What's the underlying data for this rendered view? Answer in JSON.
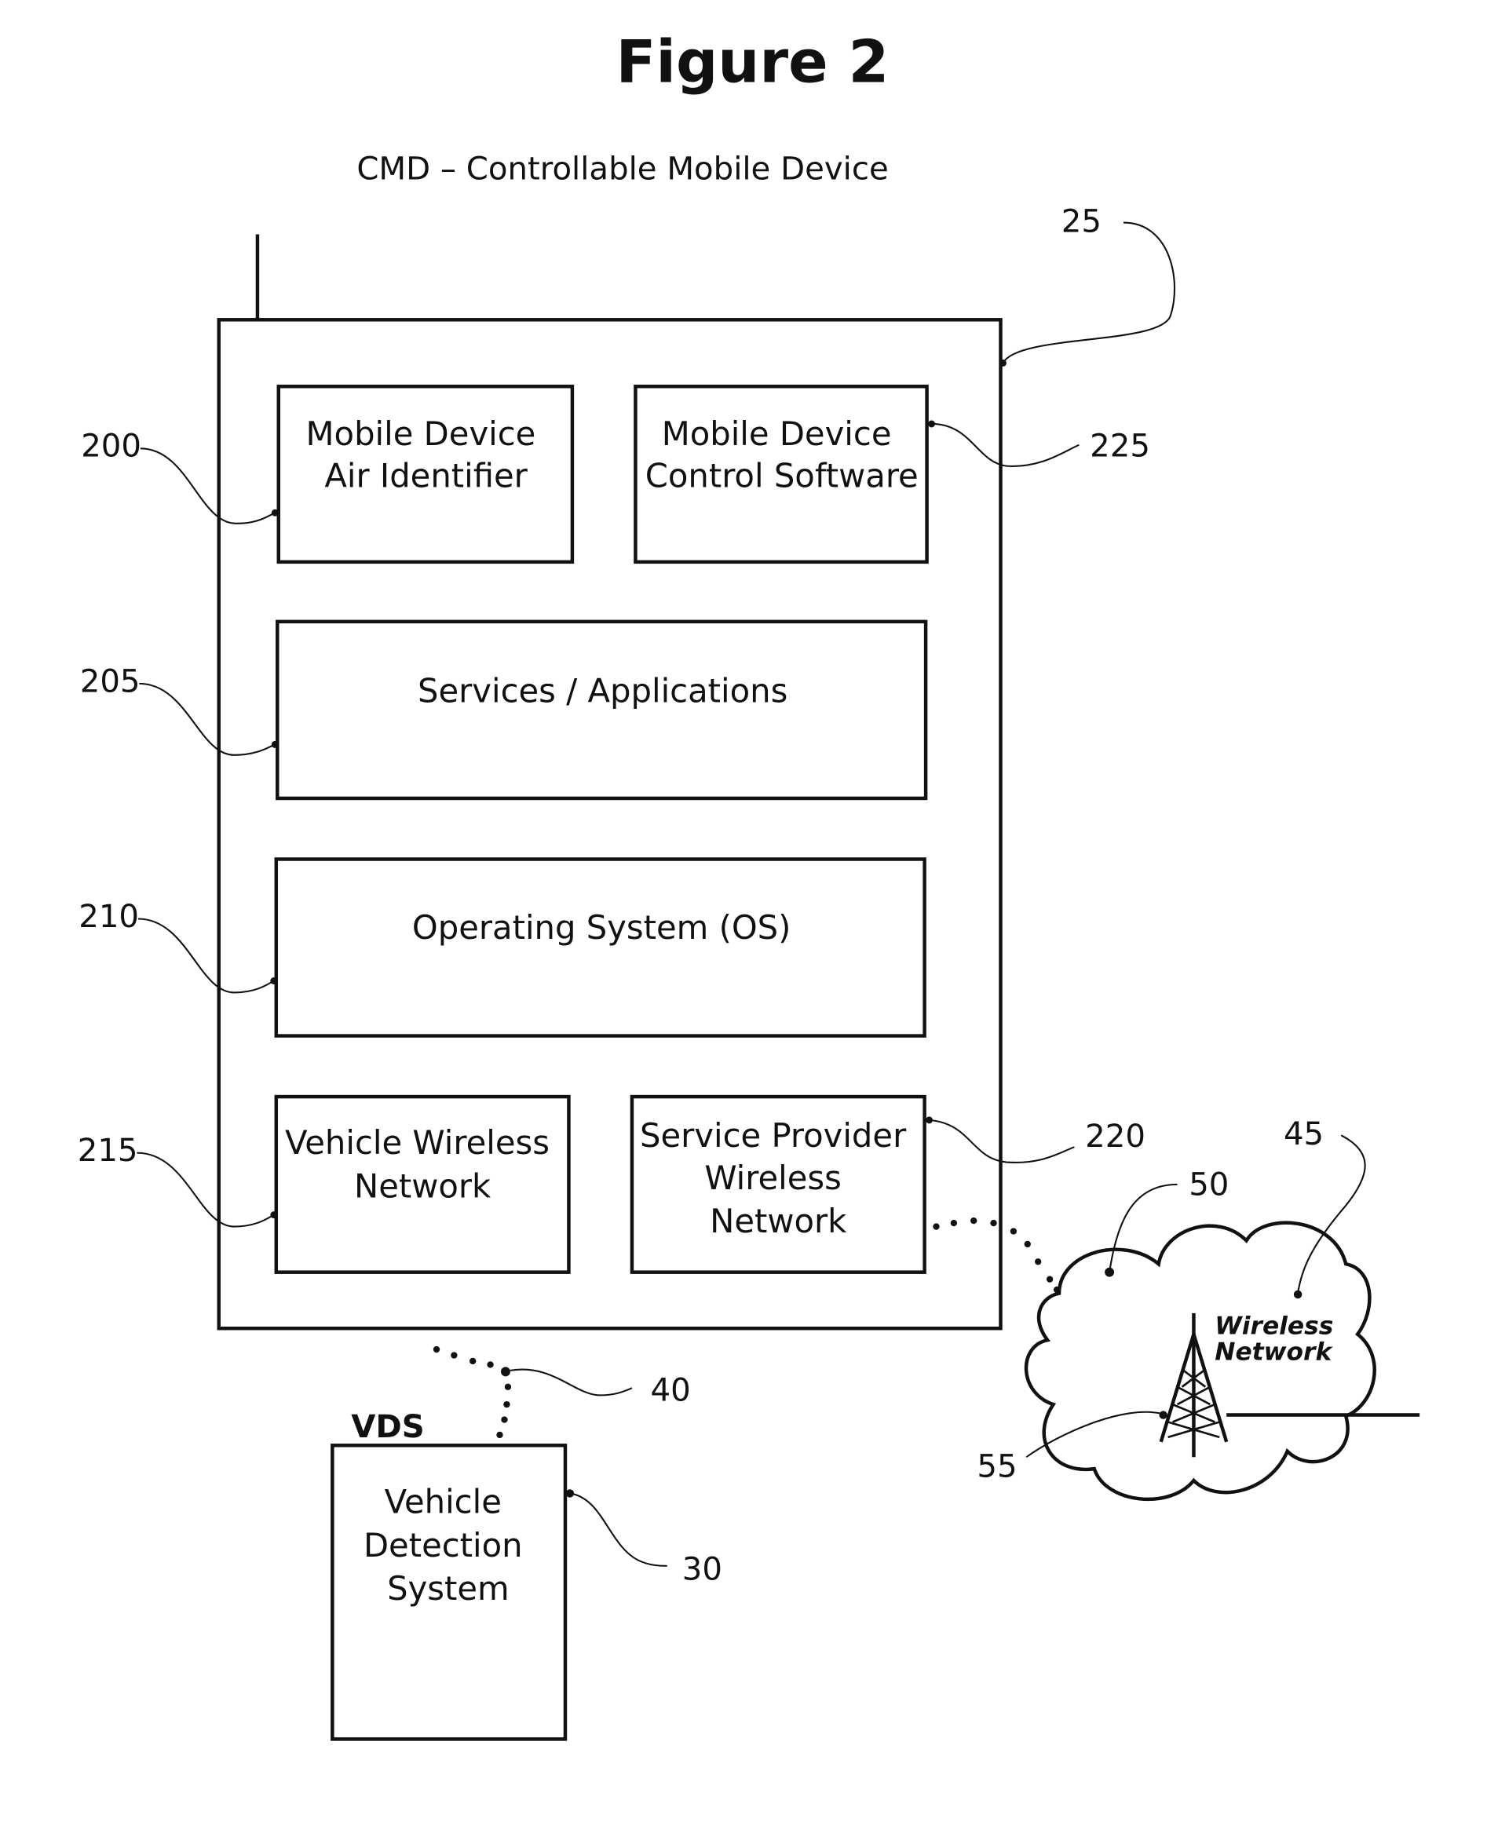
{
  "figure": {
    "title": "Figure 2",
    "subtitle": "CMD – Controllable Mobile Device"
  },
  "device": {
    "ref": "25",
    "components": [
      {
        "id": "air-identifier",
        "ref": "200",
        "lines": [
          "Mobile Device",
          "Air Identifier"
        ]
      },
      {
        "id": "control-software",
        "ref": "225",
        "lines": [
          "Mobile Device",
          "Control Software"
        ]
      },
      {
        "id": "services-applications",
        "ref": "205",
        "lines": [
          "Services / Applications"
        ]
      },
      {
        "id": "operating-system",
        "ref": "210",
        "lines": [
          "Operating System (OS)"
        ]
      },
      {
        "id": "vehicle-wireless-network",
        "ref": "215",
        "lines": [
          "Vehicle Wireless",
          "Network"
        ]
      },
      {
        "id": "service-provider-wireless-network",
        "ref": "220",
        "lines": [
          "Service Provider",
          "Wireless",
          "Network"
        ]
      }
    ]
  },
  "vds": {
    "label": "VDS",
    "ref": "30",
    "lines": [
      "Vehicle",
      "Detection",
      "System"
    ],
    "link_ref": "40"
  },
  "network": {
    "ref": "45",
    "link_ref": "50",
    "tower_ref": "55",
    "lines": [
      "Wireless",
      "Network"
    ]
  }
}
